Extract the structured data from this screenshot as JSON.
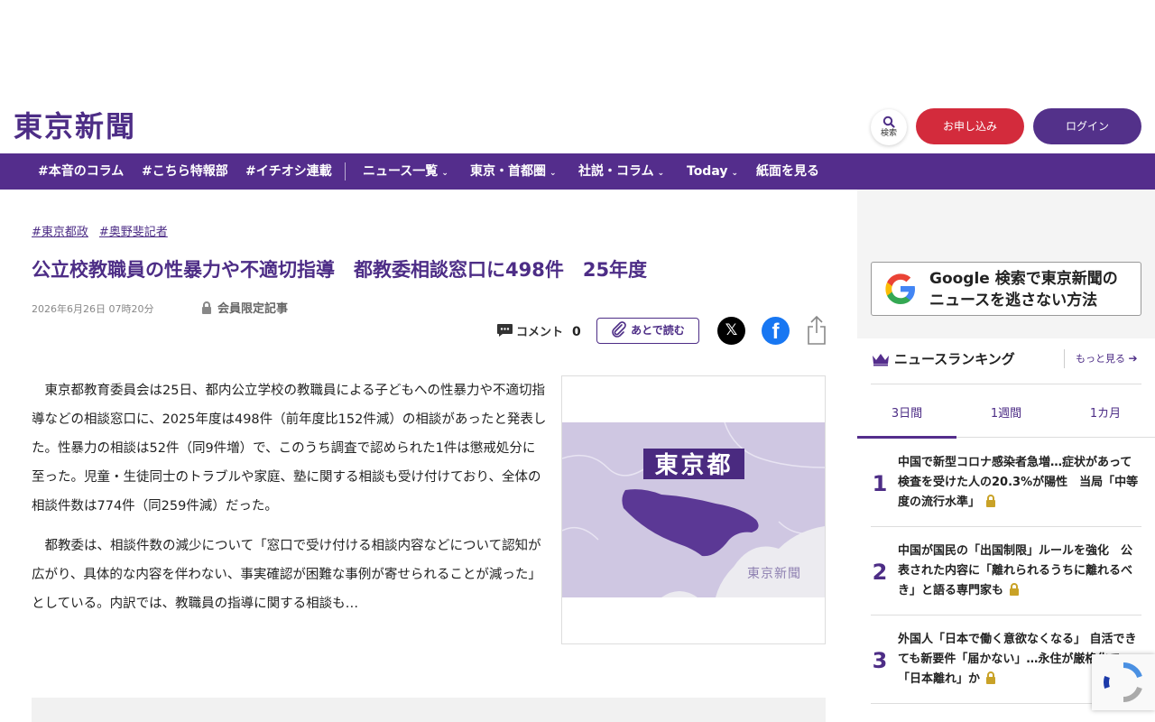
{
  "header": {
    "logo": "東京新聞",
    "search_label": "検索",
    "apply_label": "お申し込み",
    "login_label": "ログイン"
  },
  "nav": {
    "items": [
      {
        "label": "#本音のコラム"
      },
      {
        "label": "#こちら特報部"
      },
      {
        "label": "#イチオシ連載"
      },
      {
        "label": "ニュース一覧",
        "dropdown": true
      },
      {
        "label": "東京・首都圏",
        "dropdown": true
      },
      {
        "label": "社説・コラム",
        "dropdown": true
      },
      {
        "label": "Today",
        "dropdown": true
      },
      {
        "label": "紙面を見る"
      }
    ],
    "chevron": "⌄"
  },
  "article": {
    "tags": [
      "#東京都政",
      "#奥野斐記者"
    ],
    "title": "公立校教職員の性暴力や不適切指導　都教委相談窓口に498件　25年度",
    "date": "2026年6月26日 07時20分",
    "members_only": "会員限定記事",
    "comment_label": "コメント",
    "comment_count": "0",
    "read_later": "あとで読む",
    "paragraphs": [
      "東京都教育委員会は25日、都内公立学校の教職員による子どもへの性暴力や不適切指導などの相談窓口に、2025年度は498件（前年度比152件減）の相談があったと発表した。性暴力の相談は52件（同9件増）で、このうち調査で認められた1件は懲戒処分に至った。児童・生徒同士のトラブルや家庭、塾に関する相談も受け付けており、全体の相談件数は774件（同259件減）だった。",
      "都教委は、相談件数の減少について「窓口で受け付ける相談内容などについて認知が広がり、具体的な内容を伴わない、事実確認が困難な事例が寄せられることが減った」としている。内訳では、教職員の指導に関する相談も…"
    ],
    "image": {
      "label": "東京都",
      "watermark": "東京新聞"
    }
  },
  "sidebar": {
    "google_banner_line1": "Google 検索で東京新聞の",
    "google_banner_line2": "ニュースを逃さない方法",
    "ranking_title": "ニュースランキング",
    "ranking_more": "もっと見る",
    "tabs": [
      "3日間",
      "1週間",
      "1カ月"
    ],
    "ranking": [
      {
        "rank": "1",
        "text": "中国で新型コロナ感染者急増…症状があって検査を受けた人の20.3%が陽性　当局「中等度の流行水準」"
      },
      {
        "rank": "2",
        "text": "中国が国民の「出国制限」ルールを強化　公表された内容に「離れられるうちに離れるべき」と語る専門家も"
      },
      {
        "rank": "3",
        "text": "外国人「日本で働く意欲なくなる」 自活できても新要件「届かない」…永住が厳格化で「日本離れ」か"
      }
    ]
  },
  "colors": {
    "brand_purple": "#542d8c",
    "apply_red": "#d32b3c",
    "lock_gold": "#c9a227"
  }
}
